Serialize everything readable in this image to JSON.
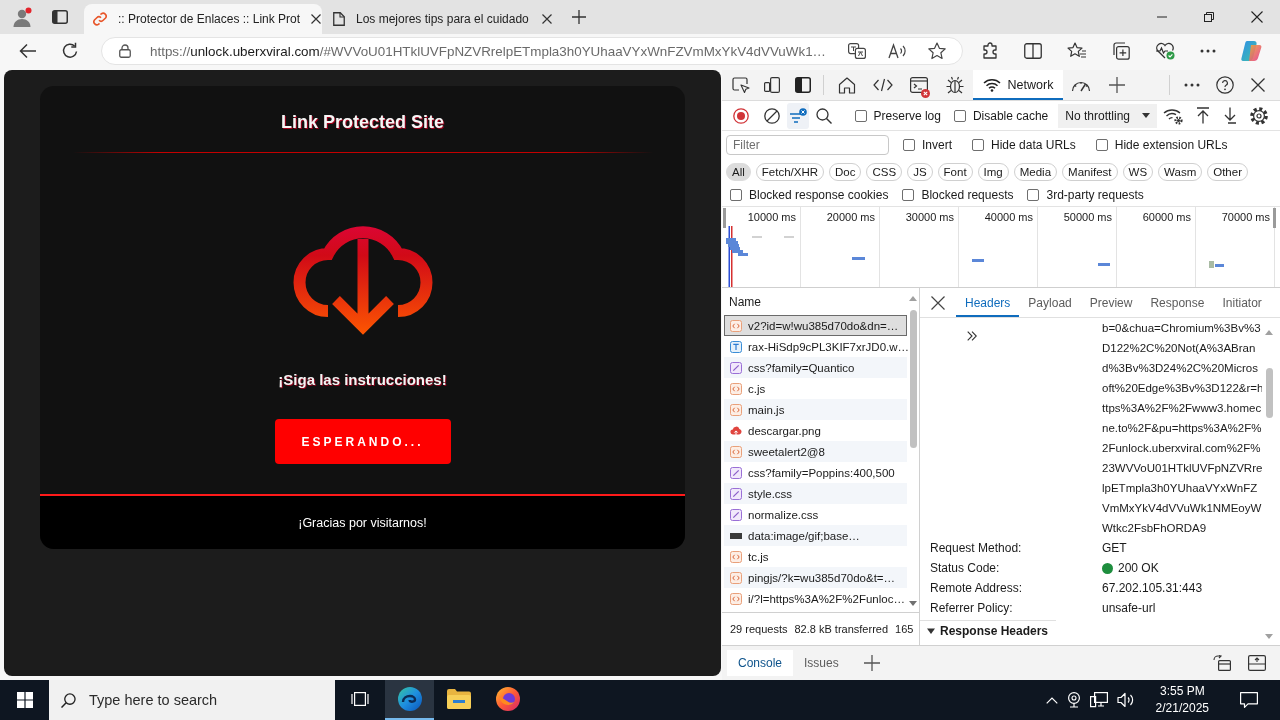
{
  "browser": {
    "tabs": [
      {
        "kind": "link",
        "title": ":: Protector de Enlaces :: Link Prot",
        "selected": true
      },
      {
        "kind": "page",
        "title": "Los mejores tips para el cuidado",
        "selected": false
      }
    ],
    "address": {
      "scheme": "https://",
      "host": "unlock.uberxviral.com",
      "path": "/#WVVoU01HTklUVFpNZVRrelpETmpla3h0YUhaaVYxWnFZVmMxYkV4dVVuWk1…"
    }
  },
  "page": {
    "title": "Link Protected Site",
    "message": "¡Siga las instrucciones!",
    "button": "ESPERANDO...",
    "footer": "¡Gracias por visitarnos!"
  },
  "devtools": {
    "panels": [
      {
        "kind": "welcome",
        "selected": false,
        "error_badge": false
      },
      {
        "kind": "elements",
        "selected": false,
        "error_badge": false
      },
      {
        "kind": "console",
        "selected": false,
        "error_badge": true
      },
      {
        "kind": "sources",
        "selected": false,
        "error_badge": false
      },
      {
        "kind": "network",
        "label": "Network",
        "selected": true,
        "error_badge": false
      },
      {
        "kind": "performance",
        "selected": false,
        "error_badge": false
      }
    ],
    "recording": true,
    "filter_shown": true,
    "options": [
      {
        "label": "Preserve log",
        "checked": false
      },
      {
        "label": "Disable cache",
        "checked": false
      }
    ],
    "throttling": "No throttling",
    "filter": {
      "placeholder": "Filter",
      "options": [
        {
          "label": "Invert",
          "checked": false
        },
        {
          "label": "Hide data URLs",
          "checked": false
        },
        {
          "label": "Hide extension URLs",
          "checked": false
        }
      ]
    },
    "types": [
      {
        "label": "All",
        "selected": true
      },
      {
        "label": "Fetch/XHR",
        "selected": false
      },
      {
        "label": "Doc",
        "selected": false
      },
      {
        "label": "CSS",
        "selected": false
      },
      {
        "label": "JS",
        "selected": false
      },
      {
        "label": "Font",
        "selected": false
      },
      {
        "label": "Img",
        "selected": false
      },
      {
        "label": "Media",
        "selected": false
      },
      {
        "label": "Manifest",
        "selected": false
      },
      {
        "label": "WS",
        "selected": false
      },
      {
        "label": "Wasm",
        "selected": false
      },
      {
        "label": "Other",
        "selected": false
      }
    ],
    "more_filters": [
      {
        "label": "Blocked response cookies",
        "checked": false
      },
      {
        "label": "Blocked requests",
        "checked": false
      },
      {
        "label": "3rd-party requests",
        "checked": false
      }
    ],
    "overview": {
      "ticks": [
        "10000 ms",
        "20000 ms",
        "30000 ms",
        "40000 ms",
        "50000 ms",
        "60000 ms",
        "70000 ms"
      ]
    },
    "requests": {
      "column": "Name",
      "rows": [
        {
          "kind": "script",
          "name": "v2?id=w!wu385d70do&dn=…",
          "selected": true
        },
        {
          "kind": "font",
          "name": "rax-HiSdp9cPL3KIF7xrJD0.w…",
          "selected": false
        },
        {
          "kind": "stylesheet",
          "name": "css?family=Quantico",
          "selected": false
        },
        {
          "kind": "script",
          "name": "c.js",
          "selected": false
        },
        {
          "kind": "script",
          "name": "main.js",
          "selected": false
        },
        {
          "kind": "image",
          "name": "descargar.png",
          "selected": false
        },
        {
          "kind": "script",
          "name": "sweetalert2@8",
          "selected": false
        },
        {
          "kind": "stylesheet",
          "name": "css?family=Poppins:400,500",
          "selected": false
        },
        {
          "kind": "stylesheet",
          "name": "style.css",
          "selected": false
        },
        {
          "kind": "stylesheet",
          "name": "normalize.css",
          "selected": false
        },
        {
          "kind": "data",
          "name": "data:image/gif;base…",
          "selected": false
        },
        {
          "kind": "script",
          "name": "tc.js",
          "selected": false
        },
        {
          "kind": "script",
          "name": "pingjs/?k=wu385d70do&t=…",
          "selected": false
        },
        {
          "kind": "script",
          "name": "i/?l=https%3A%2F%2Funloc…",
          "selected": false
        }
      ]
    },
    "summary": [
      "29 requests",
      "82.8 kB transferred",
      "165"
    ],
    "detail": {
      "tabs": [
        {
          "label": "Headers",
          "selected": true
        },
        {
          "label": "Payload",
          "selected": false
        },
        {
          "label": "Preview",
          "selected": false
        },
        {
          "label": "Response",
          "selected": false
        },
        {
          "label": "Initiator",
          "selected": false
        }
      ],
      "url_tail": "b=0&chua=Chromium%3Bv%3D122%2C%20Not(A%3ABrand%3Bv%3D24%2C%20Microsoft%20Edge%3Bv%3D122&r=https%3A%2F%2Fwww3.homecine.to%2F&pu=https%3A%2F%2Funlock.uberxviral.com%2F%23WVVoU01HTklUVFpNZVRrelpETmpla3h0YUhaaVYxWnFZVmMxYkV4dVVuWk1NMEoyWWtkc2FsbFhORDA9",
      "rows": [
        {
          "kind": "text",
          "name": "Request Method:",
          "value": "GET"
        },
        {
          "kind": "status",
          "name": "Status Code:",
          "value": "200 OK"
        },
        {
          "kind": "text",
          "name": "Remote Address:",
          "value": "67.202.105.31:443"
        },
        {
          "kind": "text",
          "name": "Referrer Policy:",
          "value": "unsafe-url"
        }
      ],
      "section": {
        "title": "Response Headers",
        "expanded": true
      }
    },
    "drawer": {
      "tabs": [
        {
          "label": "Console",
          "selected": true
        },
        {
          "label": "Issues",
          "selected": false
        }
      ]
    }
  },
  "taskbar": {
    "search_placeholder": "Type here to search",
    "apps": [
      {
        "kind": "task-view",
        "selected": false
      },
      {
        "kind": "edge",
        "selected": true
      },
      {
        "kind": "explorer",
        "selected": false
      },
      {
        "kind": "firefox",
        "selected": false
      }
    ],
    "time": "3:55 PM",
    "date": "2/21/2025"
  }
}
